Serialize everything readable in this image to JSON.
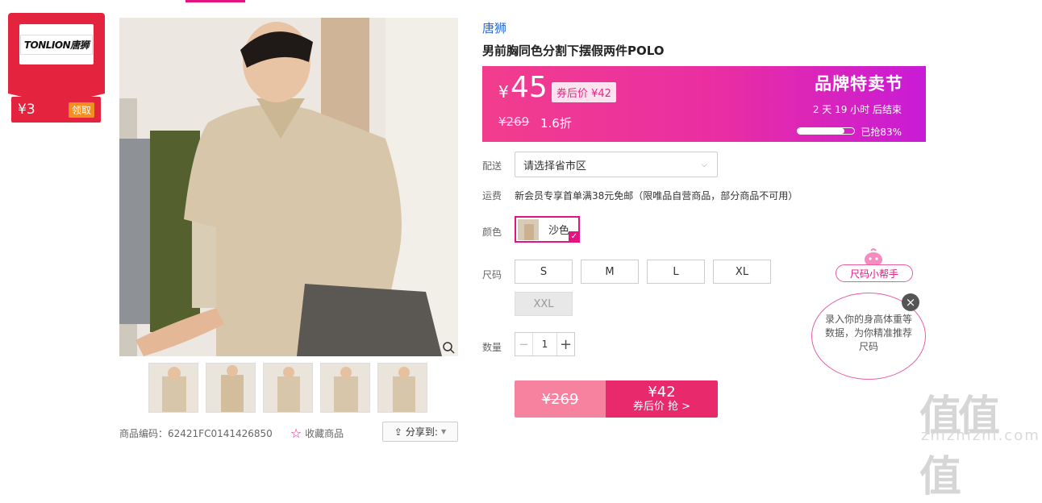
{
  "coupon": {
    "brand": "TONLION唐狮",
    "amount": "¥3",
    "button": "领取"
  },
  "product": {
    "brand_link": "唐狮",
    "title": "男前胸同色分割下摆假两件POLO",
    "sku_label": "商品编码：62421FC0141426850",
    "favorite": "收藏商品",
    "share": "分享到:"
  },
  "price_band": {
    "yen": "¥",
    "price": "45",
    "coupon_price": "券后价 ¥42",
    "original": "¥269",
    "discount": "1.6折",
    "event": "品牌特卖节",
    "countdown": "2 天 19 小时 后结束",
    "sold_label": "已抢83%",
    "sold_fraction": 0.83
  },
  "delivery": {
    "label": "配送",
    "placeholder": "请选择省市区"
  },
  "shipping": {
    "label": "运费",
    "text": "新会员专享首单满38元免邮（限唯品自营商品，部分商品不可用）"
  },
  "color": {
    "label": "颜色",
    "selected": "沙色"
  },
  "size": {
    "label": "尺码",
    "options": [
      "S",
      "M",
      "L",
      "XL",
      "XXL"
    ],
    "disabled": [
      "XXL"
    ]
  },
  "quantity": {
    "label": "数量",
    "value": "1",
    "minus": "−",
    "plus": "+"
  },
  "buy": {
    "original": "¥269",
    "price": "¥42",
    "cta": "券后价 抢 >"
  },
  "size_helper": {
    "tag": "尺码小帮手",
    "text": "录入你的身高体重等数据，为你精准推荐尺码",
    "close": "×"
  },
  "watermark": {
    "logo": "值值值",
    "domain": "zhizhizhi.com"
  }
}
